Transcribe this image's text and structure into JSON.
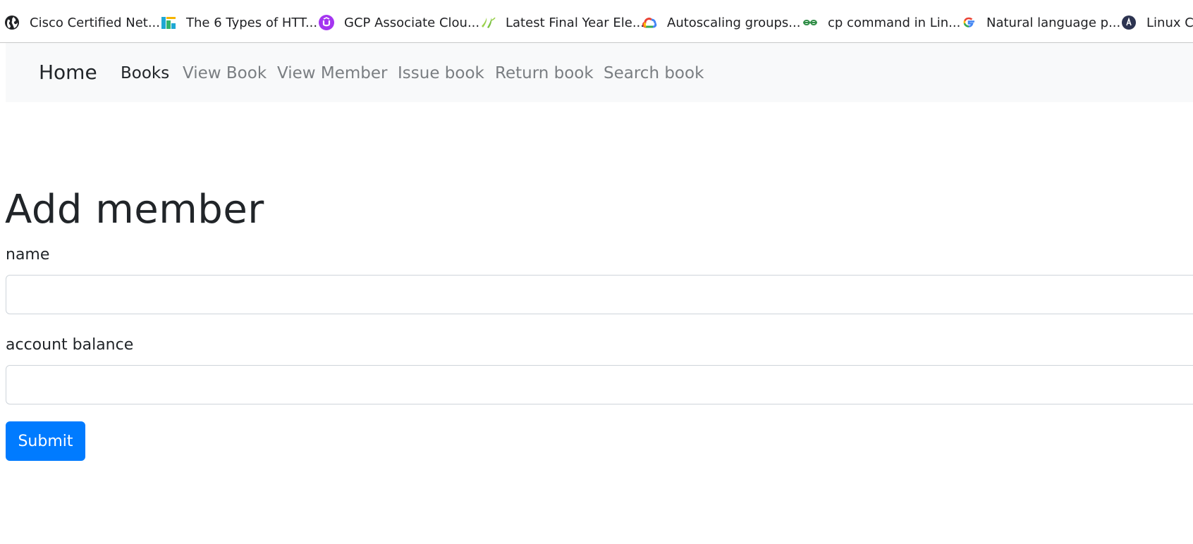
{
  "bookmarks": [
    {
      "label": "Cisco Certified Net...",
      "icon": "globe-icon"
    },
    {
      "label": "The 6 Types of HTT...",
      "icon": "site-icon"
    },
    {
      "label": "GCP Associate Clou...",
      "icon": "udemy-icon"
    },
    {
      "label": "Latest Final Year Ele...",
      "icon": "leaf-icon"
    },
    {
      "label": "Autoscaling groups...",
      "icon": "google-cloud-icon"
    },
    {
      "label": "cp command in Lin...",
      "icon": "geeksforgeeks-icon"
    },
    {
      "label": "Natural language p...",
      "icon": "google-icon"
    },
    {
      "label": "Linux Co",
      "icon": "dark-circle-icon"
    }
  ],
  "navbar": {
    "brand": "Home",
    "links": [
      {
        "label": "Books",
        "active": true
      },
      {
        "label": "View Book",
        "active": false
      },
      {
        "label": "View Member",
        "active": false
      },
      {
        "label": "Issue book",
        "active": false
      },
      {
        "label": "Return book",
        "active": false
      },
      {
        "label": "Search book",
        "active": false
      }
    ]
  },
  "form": {
    "title": "Add member",
    "fields": [
      {
        "label": "name",
        "value": "",
        "placeholder": ""
      },
      {
        "label": "account balance",
        "value": "",
        "placeholder": ""
      }
    ],
    "submit_label": "Submit"
  },
  "colors": {
    "navbar_bg": "#f8f9fa",
    "primary": "#007bff",
    "nav_inactive": "#7a7e82",
    "text": "#212529"
  }
}
